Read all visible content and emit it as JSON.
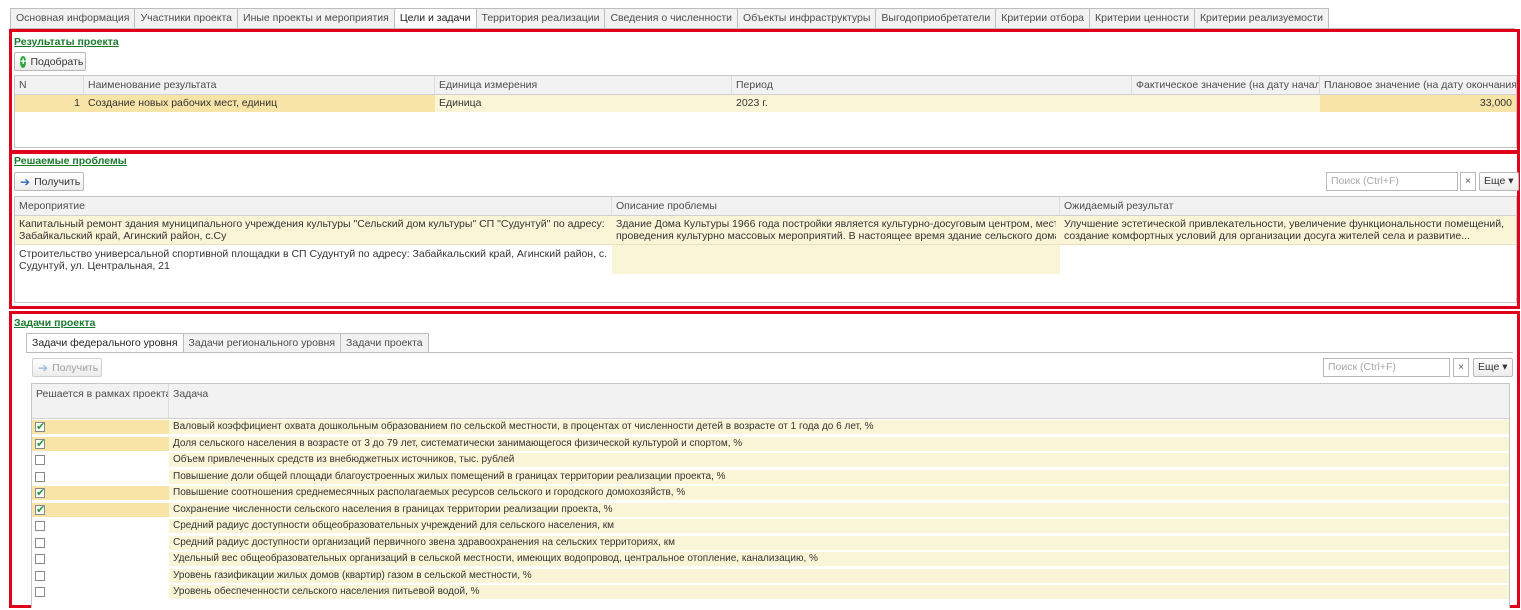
{
  "tabs": [
    "Основная информация",
    "Участники проекта",
    "Иные проекты и мероприятия",
    "Цели и задачи",
    "Территория реализации",
    "Сведения о численности",
    "Объекты инфраструктуры",
    "Выгодоприобретатели",
    "Критерии отбора",
    "Критерии ценности",
    "Критерии реализуемости"
  ],
  "active_tab": "Цели и задачи",
  "results": {
    "title": "Результаты проекта",
    "button": "Подобрать",
    "columns": [
      "N",
      "Наименование результата",
      "Единица измерения",
      "Период",
      "Фактическое значение (на дату начала)",
      "Плановое значение (на дату окончания)"
    ],
    "rows": [
      {
        "n": "1",
        "name": "Создание новых рабочих мест, единиц",
        "unit": "Единица",
        "period": "2023 г.",
        "actual": "",
        "planned": "33,000"
      }
    ]
  },
  "problems": {
    "title": "Решаемые проблемы",
    "button": "Получить",
    "search_placeholder": "Поиск (Ctrl+F)",
    "clear": "×",
    "more": "Еще ▾",
    "columns": [
      "Мероприятие",
      "Описание проблемы",
      "Ожидаемый результат"
    ],
    "rows": [
      {
        "event_line1": "Капитальный ремонт здания муниципального учреждения культуры \"Сельский дом культуры\" СП \"Судунтуй\" по адресу:",
        "event_line2": "Забайкальский край, Агинский район, с.Су",
        "desc_line1": "Здание Дома Культуры 1966 года постройки является культурно-досуговым центром, местом",
        "desc_line2": "проведения культурно массовых мероприятий. В настоящее время здание сельского дома...",
        "result_line1": "Улучшение эстетической привлекательности, увеличение функциональности помещений,",
        "result_line2": "создание комфортных условий для организации досуга жителей села и развитие..."
      },
      {
        "event_line1": "Строительство универсальной спортивной площадки в СП Судунтуй по адресу: Забайкальский край, Агинский район, с.",
        "event_line2": "Судунтуй, ул. Центральная, 21",
        "desc_line1": "",
        "desc_line2": "",
        "result_line1": "",
        "result_line2": ""
      }
    ]
  },
  "tasks": {
    "title": "Задачи проекта",
    "subtabs": [
      "Задачи федерального уровня",
      "Задачи регионального уровня",
      "Задачи проекта"
    ],
    "active_subtab": "Задачи федерального уровня",
    "button": "Получить",
    "search_placeholder": "Поиск (Ctrl+F)",
    "clear": "×",
    "more": "Еще ▾",
    "columns": [
      "Решается в рамках проекта",
      "Задача"
    ],
    "rows": [
      {
        "checked": true,
        "text": "Валовый коэффициент охвата дошкольным образованием по сельской местности, в процентах от численности детей в возрасте от 1 года до 6 лет, %"
      },
      {
        "checked": true,
        "text": "Доля сельского населения в возрасте от 3 до 79 лет, систематически занимающегося физической культурой и спортом, %"
      },
      {
        "checked": false,
        "text": "Объем привлеченных средств из внебюджетных источников, тыс. рублей"
      },
      {
        "checked": false,
        "text": "Повышение доли общей площади благоустроенных жилых помещений в границах территории реализации проекта, %"
      },
      {
        "checked": true,
        "text": "Повышение соотношения среднемесячных располагаемых ресурсов сельского и городского домохозяйств, %"
      },
      {
        "checked": true,
        "text": "Сохранение численности сельского населения в границах территории реализации проекта, %"
      },
      {
        "checked": false,
        "text": "Средний радиус доступности общеобразовательных учреждений для сельского населения, км"
      },
      {
        "checked": false,
        "text": "Средний радиус доступности организаций первичного звена здравоохранения на сельских территориях, км"
      },
      {
        "checked": false,
        "text": "Удельный вес общеобразовательных организаций в сельской местности, имеющих водопровод, центральное отопление, канализацию, %"
      },
      {
        "checked": false,
        "text": "Уровень газификации жилых домов (квартир) газом в сельской местности, %"
      },
      {
        "checked": false,
        "text": "Уровень обеспеченности сельского населения питьевой водой, %"
      }
    ]
  },
  "colors": {
    "highlight": "#e0001b",
    "link_green": "#1a7a2e",
    "row_yellow": "#fbf5d7",
    "selected_yellow": "#f9e4a7"
  }
}
